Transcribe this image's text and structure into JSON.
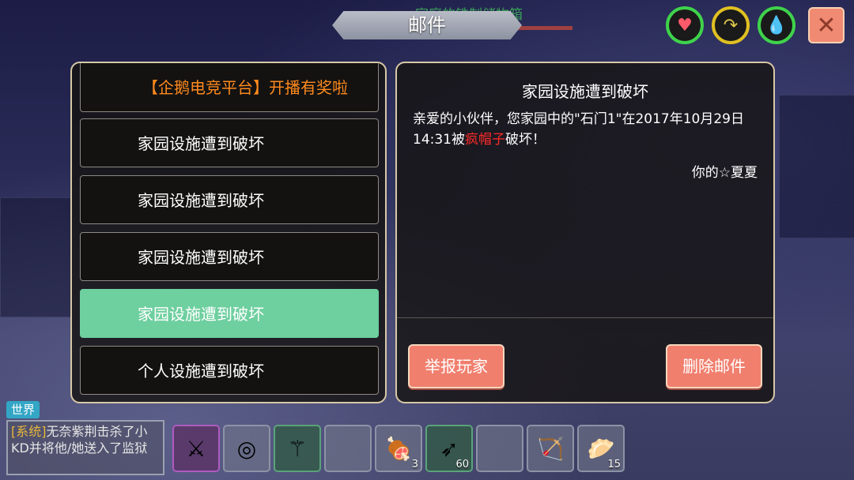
{
  "header": {
    "title": "邮件",
    "storage_label": "家庭的铁制储物箱"
  },
  "status_icons": [
    {
      "name": "heart-icon",
      "glyph": "♥",
      "color": "#ff5a6a"
    },
    {
      "name": "hunger-icon",
      "glyph": "↷",
      "color": "#e0c84a"
    },
    {
      "name": "water-icon",
      "glyph": "💧",
      "color": "#55c8f0"
    }
  ],
  "close_label": "✕",
  "mail_list": [
    {
      "title": "【企鹅电竞平台】开播有奖啦",
      "type": "promo"
    },
    {
      "title": "家园设施遭到破坏",
      "type": "normal"
    },
    {
      "title": "家园设施遭到破坏",
      "type": "normal"
    },
    {
      "title": "家园设施遭到破坏",
      "type": "normal"
    },
    {
      "title": "家园设施遭到破坏",
      "type": "selected"
    },
    {
      "title": "个人设施遭到破坏",
      "type": "normal"
    }
  ],
  "detail": {
    "title": "家园设施遭到破坏",
    "body_pre": "亲爱的小伙伴，您家园中的\"石门1\"在2017年10月29日 14:31被",
    "highlight": "疯帽子",
    "body_post": "破坏！",
    "signature": "你的☆夏夏",
    "report_label": "举报玩家",
    "delete_label": "删除邮件"
  },
  "chat": {
    "channel": "世界",
    "system_tag": "[系统]",
    "message": "无奈紫荆击杀了小KD并将他/她送入了监狱"
  },
  "hotbar": [
    {
      "icon": "spear-icon",
      "glyph": "⚔",
      "style": "purple",
      "count": ""
    },
    {
      "icon": "disc-icon",
      "glyph": "◎",
      "style": "",
      "count": ""
    },
    {
      "icon": "staff-icon",
      "glyph": "⚚",
      "style": "green",
      "count": ""
    },
    {
      "icon": "empty-slot",
      "glyph": "",
      "style": "",
      "count": ""
    },
    {
      "icon": "meat-icon",
      "glyph": "🍖",
      "style": "",
      "count": "3"
    },
    {
      "icon": "arrow-icon",
      "glyph": "➶",
      "style": "green",
      "count": "60"
    },
    {
      "icon": "empty-slot",
      "glyph": "",
      "style": "",
      "count": ""
    },
    {
      "icon": "bow-icon",
      "glyph": "🏹",
      "style": "",
      "count": ""
    },
    {
      "icon": "dumpling-icon",
      "glyph": "🥟",
      "style": "",
      "count": "15"
    }
  ]
}
